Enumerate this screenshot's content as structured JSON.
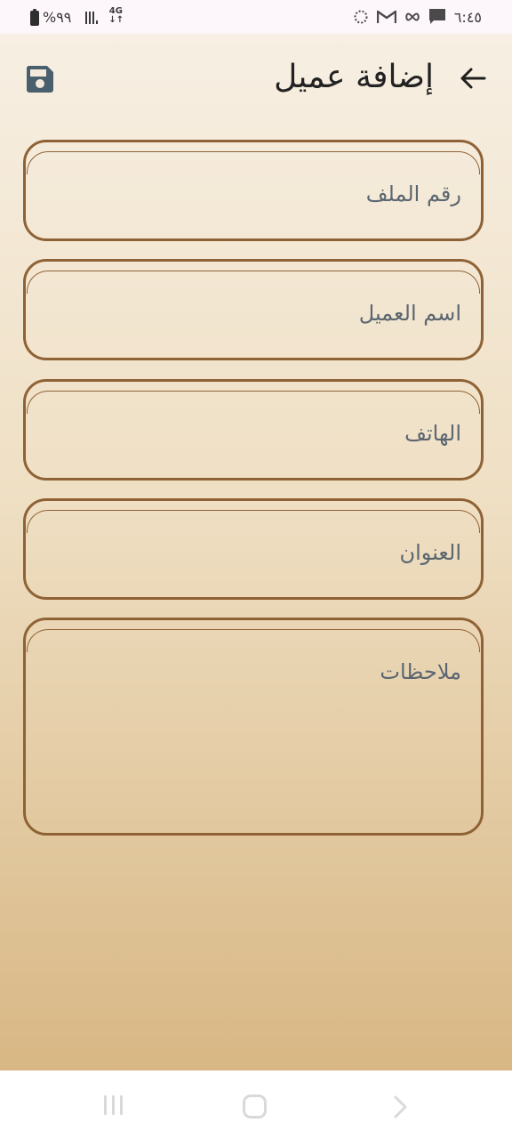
{
  "status_bar": {
    "battery_icon": "battery-full-icon",
    "battery_text": "%٩٩",
    "signal_icon": "signal-bars-icon",
    "network_type": "4G",
    "network_arrows": "↓↑",
    "time": "٦:٤٥",
    "right_icons": [
      "message-icon",
      "infinity-icon",
      "gmail-icon",
      "spinner-icon"
    ]
  },
  "header": {
    "title": "إضافة عميل",
    "back_icon": "arrow-back-icon",
    "save_icon": "save-floppy-icon"
  },
  "form": {
    "fields": [
      {
        "placeholder": "رقم الملف"
      },
      {
        "placeholder": "اسم العميل"
      },
      {
        "placeholder": "الهاتف"
      },
      {
        "placeholder": "العنوان"
      },
      {
        "placeholder": "ملاحظات"
      }
    ]
  },
  "nav_bar": {
    "recents_icon": "recent-apps-icon",
    "home_icon": "home-icon",
    "back_icon": "nav-back-icon"
  },
  "colors": {
    "field_border": "#8f6236",
    "placeholder_text": "#5b6670",
    "title_text": "#222222",
    "save_icon": "#4a5f6e",
    "background_top": "#f7efe3",
    "background_bottom": "#d8b784"
  }
}
